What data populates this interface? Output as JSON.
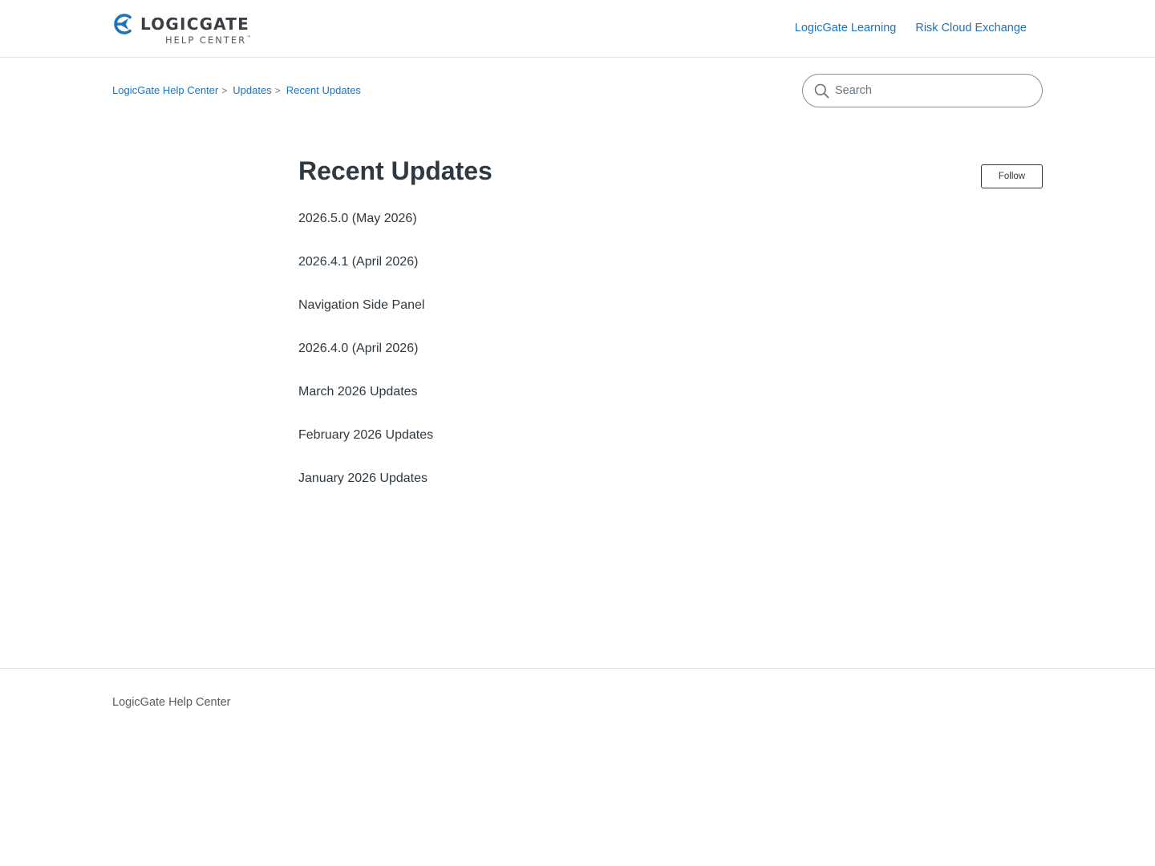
{
  "header": {
    "logo": {
      "word": "LOGICGATE",
      "sub": "HELP CENTER",
      "trademark": "™",
      "brand_color": "#1f73b7"
    },
    "nav": [
      {
        "label": "LogicGate Learning"
      },
      {
        "label": "Risk Cloud Exchange"
      }
    ]
  },
  "breadcrumbs": [
    {
      "label": "LogicGate Help Center"
    },
    {
      "label": "Updates"
    },
    {
      "label": "Recent Updates"
    }
  ],
  "breadcrumb_separator": ">",
  "search": {
    "placeholder": "Search",
    "value": "",
    "icon": "search-icon"
  },
  "main": {
    "title": "Recent Updates",
    "follow_label": "Follow",
    "articles": [
      {
        "label": "2026.5.0 (May 2026)"
      },
      {
        "label": "2026.4.1 (April 2026)"
      },
      {
        "label": "Navigation Side Panel"
      },
      {
        "label": "2026.4.0 (April 2026)"
      },
      {
        "label": "March 2026 Updates"
      },
      {
        "label": "February 2026 Updates"
      },
      {
        "label": "January 2026 Updates"
      }
    ]
  },
  "footer": {
    "link_label": "LogicGate Help Center"
  },
  "colors": {
    "link": "#1f73b7",
    "text": "#2f3941",
    "muted": "#68737d",
    "border": "#e3e3e3"
  }
}
